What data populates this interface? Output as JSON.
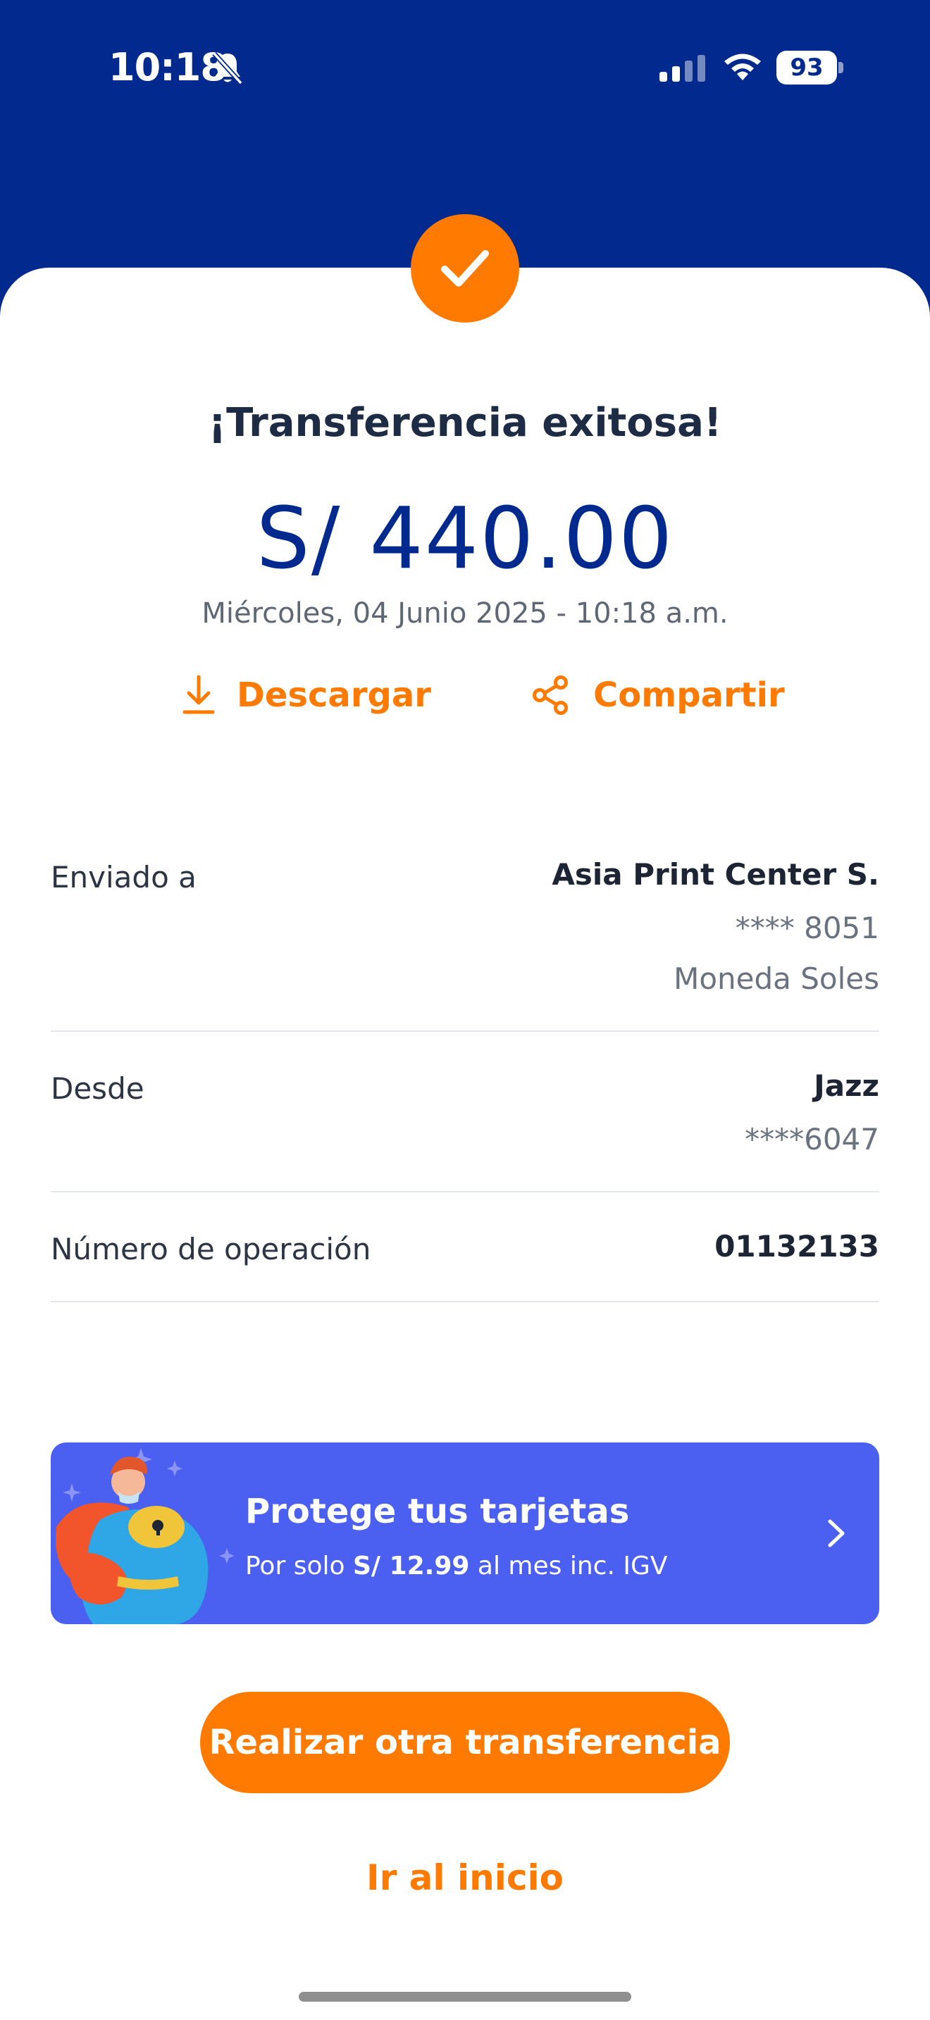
{
  "status_bar": {
    "time": "10:18",
    "battery": "93",
    "icons": [
      "bell-slash-icon",
      "cellular-signal-icon",
      "wifi-icon",
      "battery-icon"
    ]
  },
  "colors": {
    "header_blue": "#022a8e",
    "accent_orange": "#ff7a00",
    "promo_blue": "#4b5ff0",
    "text_dark": "#1d2433",
    "text_muted": "#6a7280"
  },
  "receipt": {
    "title": "¡Transferencia exitosa!",
    "amount": "S/ 440.00",
    "datetime": "Miércoles, 04 Junio 2025 - 10:18 a.m.",
    "success_icon": "check-icon"
  },
  "actions": {
    "download_label": "Descargar",
    "download_icon": "download-icon",
    "share_label": "Compartir",
    "share_icon": "share-icon"
  },
  "details": {
    "sent_to": {
      "label": "Enviado a",
      "name": "Asia Print Center S.",
      "account": "**** 8051",
      "currency": "Moneda Soles"
    },
    "from": {
      "label": "Desde",
      "name": "Jazz",
      "account": "****6047"
    },
    "operation": {
      "label": "Número de operación",
      "value": "01132133"
    }
  },
  "promo": {
    "title": "Protege tus tarjetas",
    "sub_prefix": "Por solo",
    "sub_price": "S/ 12.99",
    "sub_suffix": "al mes inc. IGV",
    "icon": "chevron-right-icon"
  },
  "buttons": {
    "primary": "Realizar otra transferencia",
    "home_link": "Ir al inicio"
  }
}
